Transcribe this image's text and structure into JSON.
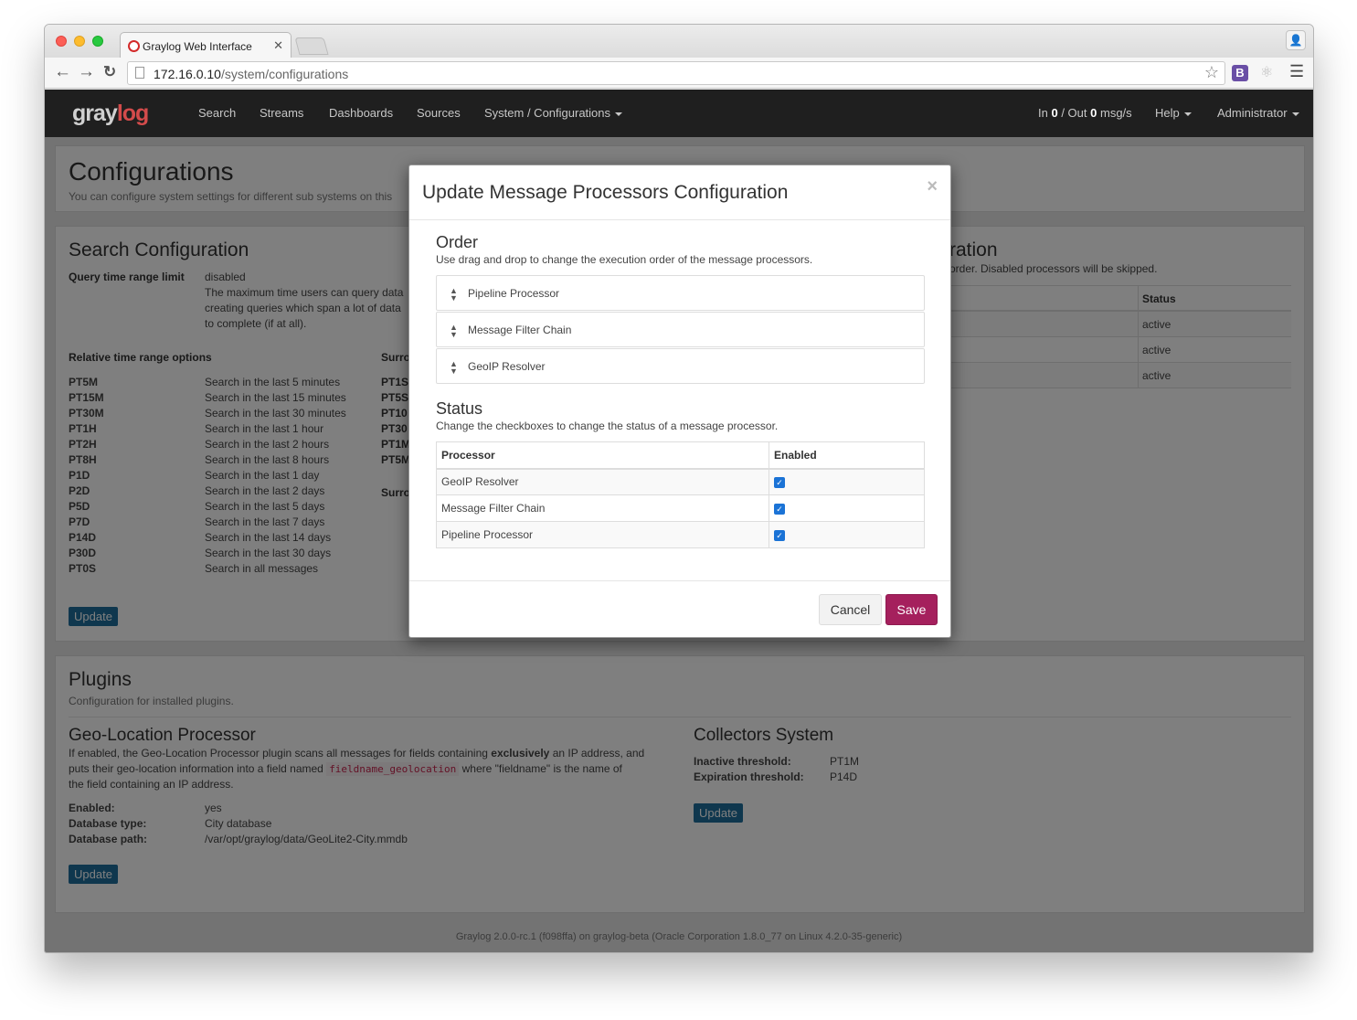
{
  "browser": {
    "tab_title": "Graylog Web Interface",
    "url_host": "172.16.0.10",
    "url_path": "/system/configurations"
  },
  "navbar": {
    "logo_a": "gray",
    "logo_b": "log",
    "items": [
      "Search",
      "Streams",
      "Dashboards",
      "Sources",
      "System / Configurations"
    ],
    "throughput_in_label": "In",
    "throughput_in": "0",
    "throughput_sep": "/ Out",
    "throughput_out": "0",
    "throughput_unit": "msg/s",
    "help": "Help",
    "user": "Administrator"
  },
  "header": {
    "title": "Configurations",
    "subtitle": "You can configure system settings for different sub systems on this"
  },
  "search_config": {
    "title": "Search Configuration",
    "query_limit_label": "Query time range limit",
    "query_limit_value": "disabled",
    "query_limit_help_1": "The maximum time users can query data",
    "query_limit_help_2": "creating queries which span a lot of data",
    "query_limit_help_3": "to complete (if at all).",
    "relative_title": "Relative time range options",
    "relative": [
      {
        "key": "PT5M",
        "desc": "Search in the last 5 minutes"
      },
      {
        "key": "PT15M",
        "desc": "Search in the last 15 minutes"
      },
      {
        "key": "PT30M",
        "desc": "Search in the last 30 minutes"
      },
      {
        "key": "PT1H",
        "desc": "Search in the last 1 hour"
      },
      {
        "key": "PT2H",
        "desc": "Search in the last 2 hours"
      },
      {
        "key": "PT8H",
        "desc": "Search in the last 8 hours"
      },
      {
        "key": "P1D",
        "desc": "Search in the last 1 day"
      },
      {
        "key": "P2D",
        "desc": "Search in the last 2 days"
      },
      {
        "key": "P5D",
        "desc": "Search in the last 5 days"
      },
      {
        "key": "P7D",
        "desc": "Search in the last 7 days"
      },
      {
        "key": "P14D",
        "desc": "Search in the last 14 days"
      },
      {
        "key": "P30D",
        "desc": "Search in the last 30 days"
      },
      {
        "key": "PT0S",
        "desc": "Search in all messages"
      }
    ],
    "surround_title": "Surro",
    "surround": [
      "PT1S",
      "PT5S",
      "PT10",
      "PT30",
      "PT1M",
      "PT5M"
    ],
    "surround2_title": "Surro",
    "update_label": "Update"
  },
  "processors_bg": {
    "title_tail": "ration",
    "help_tail": "order. Disabled processors will be skipped.",
    "status_header": "Status",
    "statuses": [
      "active",
      "active",
      "active"
    ]
  },
  "plugins": {
    "title": "Plugins",
    "subtitle": "Configuration for installed plugins.",
    "geo": {
      "title": "Geo-Location Processor",
      "desc_1": "If enabled, the Geo-Location Processor plugin scans all messages for fields containing",
      "desc_bold": "exclusively",
      "desc_2": "an IP address, and",
      "desc_3": "puts their geo-location information into a field named",
      "desc_code": "fieldname_geolocation",
      "desc_4": "where \"fieldname\" is the name of",
      "desc_5": "the field containing an IP address.",
      "enabled_label": "Enabled:",
      "enabled_value": "yes",
      "dbtype_label": "Database type:",
      "dbtype_value": "City database",
      "dbpath_label": "Database path:",
      "dbpath_value": "/var/opt/graylog/data/GeoLite2-City.mmdb",
      "update_label": "Update"
    },
    "collectors": {
      "title": "Collectors System",
      "inactive_label": "Inactive threshold:",
      "inactive_value": "PT1M",
      "expiration_label": "Expiration threshold:",
      "expiration_value": "P14D",
      "update_label": "Update"
    }
  },
  "footer": "Graylog 2.0.0-rc.1 (f098ffa) on graylog-beta (Oracle Corporation 1.8.0_77 on Linux 4.2.0-35-generic)",
  "modal": {
    "title": "Update Message Processors Configuration",
    "close": "×",
    "order_title": "Order",
    "order_help": "Use drag and drop to change the execution order of the message processors.",
    "order_items": [
      "Pipeline Processor",
      "Message Filter Chain",
      "GeoIP Resolver"
    ],
    "status_title": "Status",
    "status_help": "Change the checkboxes to change the status of a message processor.",
    "col_processor": "Processor",
    "col_enabled": "Enabled",
    "status_rows": [
      {
        "name": "GeoIP Resolver",
        "enabled": true
      },
      {
        "name": "Message Filter Chain",
        "enabled": true
      },
      {
        "name": "Pipeline Processor",
        "enabled": true
      }
    ],
    "cancel_label": "Cancel",
    "save_label": "Save"
  }
}
